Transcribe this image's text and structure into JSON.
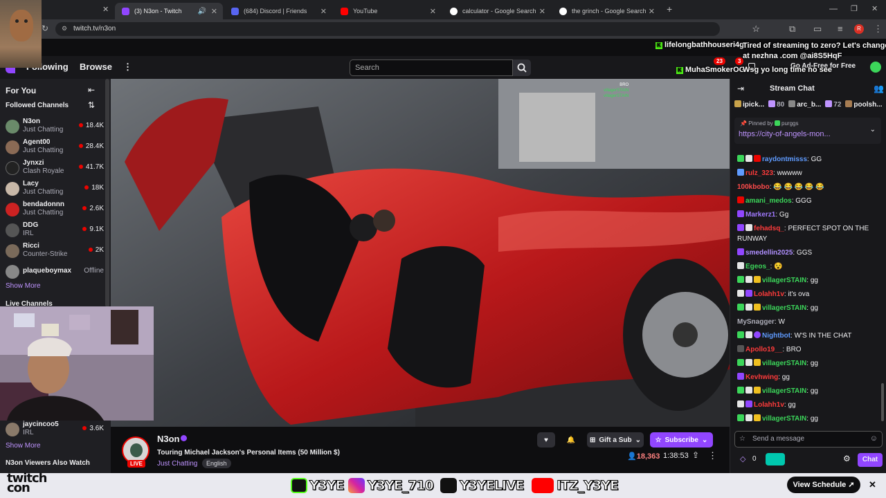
{
  "browser": {
    "tabs": [
      {
        "label": "(3) N3on - Twitch",
        "color": "#9146ff"
      },
      {
        "label": "(684) Discord | Friends",
        "color": "#5865f2"
      },
      {
        "label": "YouTube",
        "color": "#ff0000"
      },
      {
        "label": "calculator - Google Search",
        "color": "#4285f4"
      },
      {
        "label": "the grinch - Google Search",
        "color": "#4285f4"
      }
    ],
    "url": "twitch.tv/n3on",
    "profile_letter": "R"
  },
  "nav": {
    "following": "Following",
    "browse": "Browse",
    "search_placeholder": "Search",
    "notif_count": "23",
    "whisper_count": "3",
    "ad_free": "Go Ad-Free for Free"
  },
  "overlay": {
    "notif1_user": "lifelongbathhouseri4g",
    "notif1_text": "Tired of streaming to zero? Let's change the",
    "notif1_text2": "at nezhna .com @ai8S5HqF",
    "notif2_user": "MuhaSmokerOG",
    "notif2_text": "Wsg yo long time no see"
  },
  "sidebar": {
    "for_you": "For You",
    "followed_header": "Followed Channels",
    "channels": [
      {
        "name": "N3on",
        "game": "Just Chatting",
        "viewers": "18.4K",
        "color": "#6a8a6a"
      },
      {
        "name": "Agent00",
        "game": "Just Chatting",
        "viewers": "28.4K",
        "color": "#8a6a55"
      },
      {
        "name": "Jynxzi",
        "game": "Clash Royale",
        "viewers": "41.7K",
        "color": "#222"
      },
      {
        "name": "Lacy",
        "game": "Just Chatting",
        "viewers": "18K",
        "color": "#c8b8a8"
      },
      {
        "name": "bendadonnn",
        "game": "Just Chatting",
        "viewers": "2.6K",
        "color": "#cc2222"
      },
      {
        "name": "DDG",
        "game": "IRL",
        "viewers": "9.1K",
        "color": "#555"
      },
      {
        "name": "Ricci",
        "game": "Counter-Strike",
        "viewers": "2K",
        "color": "#7a6a5a"
      },
      {
        "name": "plaqueboymax",
        "game": "",
        "viewers": "Offline",
        "color": "#888"
      }
    ],
    "show_more": "Show More",
    "live_header": "Live Channels",
    "live_channel": {
      "name": "jaycincoo5",
      "game": "IRL",
      "viewers": "3.6K"
    },
    "show_more2": "Show More",
    "also_watch": "N3on Viewers Also Watch"
  },
  "stream": {
    "streamer": "N3on",
    "title": "Touring Michael Jackson's Personal Items (50 Million $)",
    "category": "Just Chatting",
    "tag": "English",
    "live_label": "LIVE",
    "gift_sub": "Gift a Sub",
    "subscribe": "Subscribe",
    "viewers": "18,363",
    "uptime": "1:38:53",
    "overlay_mini": [
      "BRO",
      "villagerSTAIN",
      "",
      "villagerSTAIN"
    ]
  },
  "chat": {
    "title": "Stream Chat",
    "leaders": [
      {
        "name": "ipick...",
        "count": ""
      },
      {
        "name": "",
        "count": "80"
      },
      {
        "name": "arc_b...",
        "count": ""
      },
      {
        "name": "",
        "count": "72"
      },
      {
        "name": "poolsh...",
        "count": ""
      }
    ],
    "pinned_by": "Pinned by",
    "pinned_user": "purggs",
    "pinned_link": "https://city-of-angels-mon...",
    "messages": [
      {
        "user": "raydontmisss",
        "text": ": GG",
        "color": "#5f9bff"
      },
      {
        "user": "rulz_323",
        "text": ": wwwww",
        "color": "#ff3b3b"
      },
      {
        "user": "100kbobo",
        "text": ": 😂 😂 😂 😂 😂",
        "color": "#ff4b4b"
      },
      {
        "user": "amani_medos",
        "text": ": GGG",
        "color": "#3cd65a"
      },
      {
        "user": "Markerz1",
        "text": ": Gg",
        "color": "#a17aff"
      },
      {
        "user": "fehadsq_",
        "text": ": PERFECT SPOT ON THE RUNWAY",
        "color": "#ff3b3b"
      },
      {
        "user": "smedellin2025",
        "text": ": GGS",
        "color": "#b090ff"
      },
      {
        "user": "Egeos_",
        "text": ": 😵",
        "color": "#3cd65a"
      },
      {
        "user": "villagerSTAIN",
        "text": ": gg",
        "color": "#3cd65a"
      },
      {
        "user": "Lolahh1v",
        "text": ": it's ova",
        "color": "#ff3b3b"
      },
      {
        "user": "villagerSTAIN",
        "text": ": gg",
        "color": "#3cd65a"
      },
      {
        "user": "MySnagger",
        "text": ": W",
        "color": "#adadb8"
      },
      {
        "user": "Nightbot",
        "text": ": W'S IN THE CHAT",
        "color": "#5f9bff"
      },
      {
        "user": "Apollo19__",
        "text": ": BRO",
        "color": "#ff3b3b"
      },
      {
        "user": "villagerSTAIN",
        "text": ": gg",
        "color": "#3cd65a"
      },
      {
        "user": "Kevhwing",
        "text": ": gg",
        "color": "#ff3b3b"
      },
      {
        "user": "villagerSTAIN",
        "text": ": gg",
        "color": "#3cd65a"
      },
      {
        "user": "Lolahh1v",
        "text": ": gg",
        "color": "#ff3b3b"
      },
      {
        "user": "villagerSTAIN",
        "text": ": gg",
        "color": "#3cd65a"
      }
    ],
    "input_placeholder": "Send a message",
    "points": "0",
    "chat_button": "Chat"
  },
  "bottom": {
    "brand_line1": "twitch",
    "brand_line2": "con",
    "socials": [
      {
        "handle": "Y3YE",
        "icon": "kick-icon",
        "color": "#53fc18"
      },
      {
        "handle": "Y3YE_710",
        "icon": "instagram-icon",
        "color": "#d6249f"
      },
      {
        "handle": "Y3YELIVE",
        "icon": "tiktok-icon",
        "color": "#111111"
      },
      {
        "handle": "ITZ_Y3YE",
        "icon": "youtube-icon",
        "color": "#ff0000"
      }
    ],
    "view_schedule": "View Schedule"
  },
  "colors": {
    "twitch_purple": "#9146ff",
    "live_red": "#eb0400",
    "kick_green": "#53fc18"
  }
}
